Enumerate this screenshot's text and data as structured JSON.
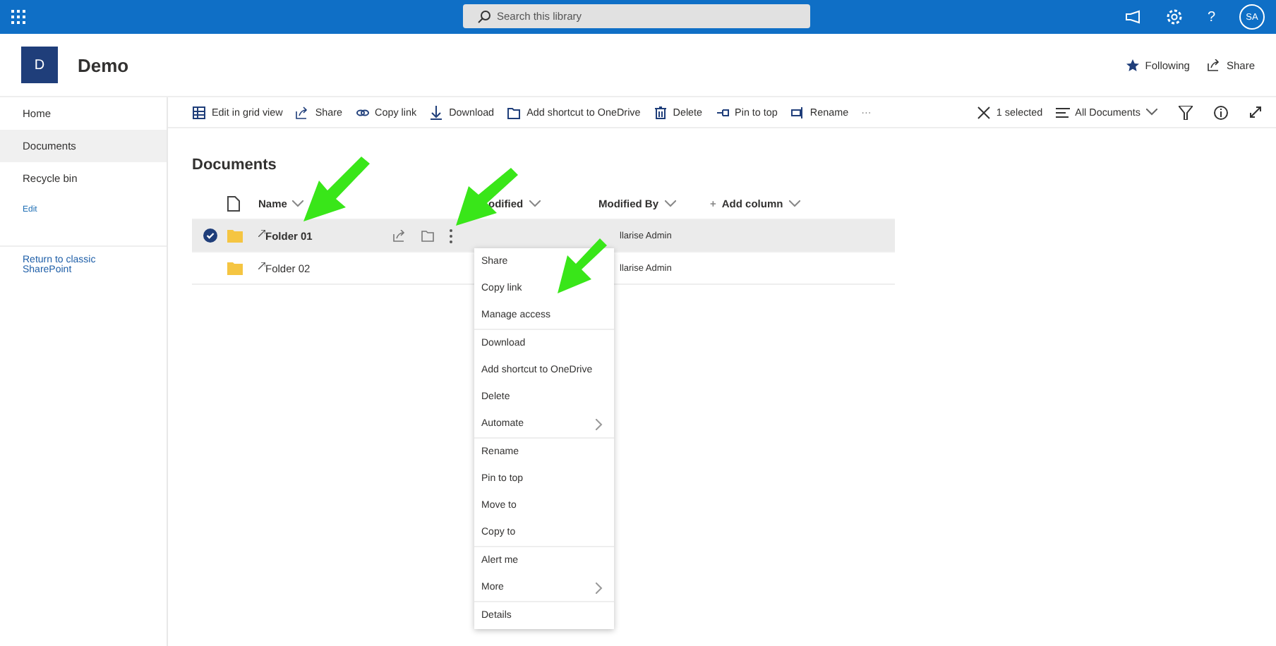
{
  "topbar": {
    "search": {
      "placeholder": "Search this library"
    },
    "help": "?",
    "avatar": "SA"
  },
  "site": {
    "logo": "D",
    "title": "Demo",
    "following": "Following",
    "share": "Share"
  },
  "sidebar": {
    "items": [
      {
        "label": "Home",
        "selected": false
      },
      {
        "label": "Documents",
        "selected": true
      },
      {
        "label": "Recycle bin",
        "selected": false
      }
    ],
    "edit": "Edit",
    "classic": "Return to classic SharePoint"
  },
  "commands": [
    "Edit in grid view",
    "Share",
    "Copy link",
    "Download",
    "Add shortcut to OneDrive",
    "Delete",
    "Pin to top",
    "Rename"
  ],
  "more": "···",
  "selection": "1 selected",
  "view": "All Documents",
  "library": {
    "title": "Documents",
    "columns": [
      "Name",
      "odified",
      "Modified By",
      "Add column"
    ],
    "add_mark": "+",
    "rows": [
      {
        "name": "Folder 01",
        "modified_by": "llarise Admin",
        "selected": true
      },
      {
        "name": "Folder 02",
        "modified_by": "llarise Admin",
        "selected": false
      }
    ]
  },
  "menu": [
    {
      "label": "Share",
      "submenu": false,
      "divider": false
    },
    {
      "label": "Copy link",
      "submenu": false,
      "divider": false
    },
    {
      "label": "Manage access",
      "submenu": false,
      "divider": true
    },
    {
      "label": "Download",
      "submenu": false,
      "divider": false
    },
    {
      "label": "Add shortcut to OneDrive",
      "submenu": false,
      "divider": false
    },
    {
      "label": "Delete",
      "submenu": false,
      "divider": false
    },
    {
      "label": "Automate",
      "submenu": true,
      "divider": true
    },
    {
      "label": "Rename",
      "submenu": false,
      "divider": false
    },
    {
      "label": "Pin to top",
      "submenu": false,
      "divider": false
    },
    {
      "label": "Move to",
      "submenu": false,
      "divider": false
    },
    {
      "label": "Copy to",
      "submenu": false,
      "divider": true
    },
    {
      "label": "Alert me",
      "submenu": false,
      "divider": false
    },
    {
      "label": "More",
      "submenu": true,
      "divider": true
    },
    {
      "label": "Details",
      "submenu": false,
      "divider": false
    }
  ]
}
